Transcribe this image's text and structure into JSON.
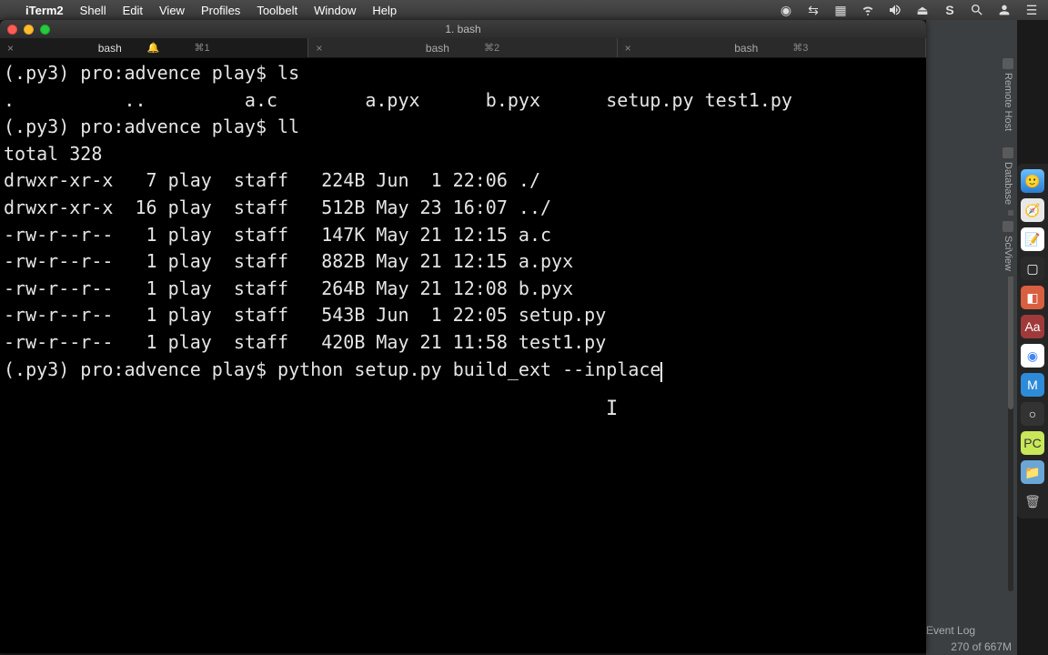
{
  "menubar": {
    "app": "iTerm2",
    "items": [
      "Shell",
      "Edit",
      "View",
      "Profiles",
      "Toolbelt",
      "Window",
      "Help"
    ]
  },
  "window": {
    "title": "1. bash",
    "tabs": [
      {
        "label": "bash",
        "shortcut": "⌘1",
        "bell": true
      },
      {
        "label": "bash",
        "shortcut": "⌘2",
        "bell": false
      },
      {
        "label": "bash",
        "shortcut": "⌘3",
        "bell": false
      }
    ]
  },
  "terminal": {
    "prompt": "(.py3) pro:advence play$",
    "cmd1": "ls",
    "ls_output": ".             ..            a.c           a.pyx         b.pyx         setup.py      test1.py",
    "cmd2": "ll",
    "ll_total": "total 328",
    "ll_rows": [
      "drwxr-xr-x   7 play  staff   224B Jun  1 22:06 ./",
      "drwxr-xr-x  16 play  staff   512B May 23 16:07 ../",
      "-rw-r--r--   1 play  staff   147K May 21 12:15 a.c",
      "-rw-r--r--   1 play  staff   882B May 21 12:15 a.pyx",
      "-rw-r--r--   1 play  staff   264B May 21 12:08 b.pyx",
      "-rw-r--r--   1 play  staff   543B Jun  1 22:05 setup.py",
      "-rw-r--r--   1 play  staff   420B May 21 11:58 test1.py"
    ],
    "cmd3": "python setup.py build_ext --inplace"
  },
  "ide": {
    "panels": [
      "Remote Host",
      "Database",
      "SciView"
    ],
    "event_log": "Event Log",
    "status": "270 of 667M"
  },
  "dock": {
    "items": [
      {
        "name": "finder",
        "bg": "#3aa0ff"
      },
      {
        "name": "safari",
        "bg": "#3b7dd8"
      },
      {
        "name": "notes",
        "bg": "#f2f2f2"
      },
      {
        "name": "pycharm-dark",
        "bg": "#2b2b2b"
      },
      {
        "name": "intellij",
        "bg": "#d85f3f"
      },
      {
        "name": "font-app",
        "bg": "#a03a3a"
      },
      {
        "name": "chrome",
        "bg": "#f2f2f2"
      },
      {
        "name": "mamp",
        "bg": "#2e8bd8"
      },
      {
        "name": "circle-app",
        "bg": "#333333"
      },
      {
        "name": "pycharm",
        "bg": "#c8e85a"
      },
      {
        "name": "files",
        "bg": "#6aa7d6"
      },
      {
        "name": "trash",
        "bg": "#6b6b6b"
      }
    ]
  }
}
